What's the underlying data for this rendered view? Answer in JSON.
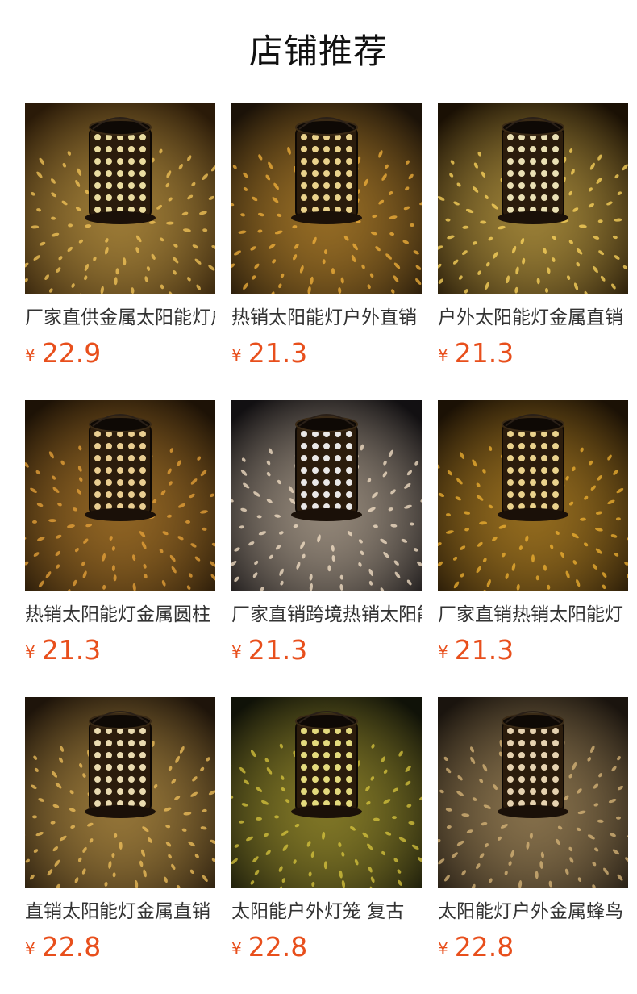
{
  "page": {
    "title": "店铺推荐",
    "accent_color": "#e84f1c"
  },
  "products": [
    {
      "name": "厂家直供金属太阳能灯户外",
      "currency": "¥",
      "price": "22.9",
      "image_icon": "solar-lantern-flower-image"
    },
    {
      "name": "热销太阳能灯户外直销",
      "currency": "¥",
      "price": "21.3",
      "image_icon": "solar-lantern-mandala-image"
    },
    {
      "name": "户外太阳能灯金属直销",
      "currency": "¥",
      "price": "21.3",
      "image_icon": "solar-lantern-butterfly-image"
    },
    {
      "name": "热销太阳能灯金属圆柱",
      "currency": "¥",
      "price": "21.3",
      "image_icon": "solar-lantern-butterfly-pot-image"
    },
    {
      "name": "厂家直销跨境热销太阳能",
      "currency": "¥",
      "price": "21.3",
      "image_icon": "solar-lantern-butterfly-dots-image"
    },
    {
      "name": "厂家直销热销太阳能灯",
      "currency": "¥",
      "price": "21.3",
      "image_icon": "solar-lantern-leaf-image"
    },
    {
      "name": "直销太阳能灯金属直销",
      "currency": "¥",
      "price": "22.8",
      "image_icon": "solar-lantern-hummingbird-image"
    },
    {
      "name": "太阳能户外灯笼 复古",
      "currency": "¥",
      "price": "22.8",
      "image_icon": "solar-lantern-sunflower-image"
    },
    {
      "name": "太阳能灯户外金属蜂鸟",
      "currency": "¥",
      "price": "22.8",
      "image_icon": "solar-lantern-bird-image"
    }
  ]
}
